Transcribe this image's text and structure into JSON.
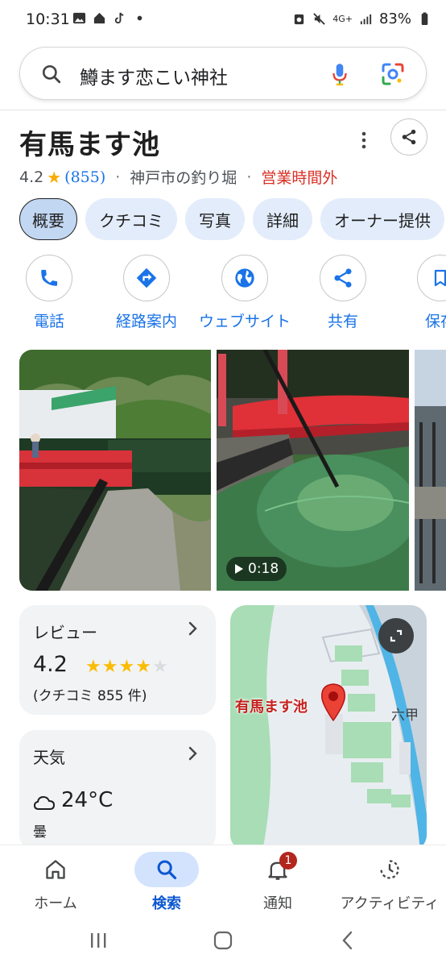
{
  "status_bar": {
    "time": "10:31",
    "network": "4G+",
    "battery": "83%"
  },
  "search": {
    "query": "鱒ます恋こい神社"
  },
  "place": {
    "title": "有馬ます池",
    "rating": "4.2",
    "review_count": "(855)",
    "category": "神戸市の釣り堀",
    "status": "営業時間外",
    "status_color": "#d93025"
  },
  "chips": [
    "概要",
    "クチコミ",
    "写真",
    "詳細",
    "オーナー提供"
  ],
  "actions": [
    {
      "label": "電話",
      "icon": "phone-icon"
    },
    {
      "label": "経路案内",
      "icon": "directions-icon"
    },
    {
      "label": "ウェブサイト",
      "icon": "globe-icon"
    },
    {
      "label": "共有",
      "icon": "share-icon"
    },
    {
      "label": "保存",
      "icon": "bookmark-icon"
    }
  ],
  "photos": {
    "video_duration": "0:18"
  },
  "review_card": {
    "title": "レビュー",
    "score": "4.2",
    "stars_filled": 4,
    "stars_total": 5,
    "count": "(クチコミ 855 件)"
  },
  "weather_card": {
    "title": "天気",
    "temp": "24°C",
    "condition": "曇"
  },
  "map": {
    "label": "有馬ます池",
    "road_label": "六甲"
  },
  "bottom_nav": [
    {
      "label": "ホーム",
      "icon": "home-icon"
    },
    {
      "label": "検索",
      "icon": "search-icon",
      "active": true
    },
    {
      "label": "通知",
      "icon": "bell-icon",
      "badge": "1"
    },
    {
      "label": "アクティビティ",
      "icon": "activity-icon"
    }
  ],
  "colors": {
    "accent_blue": "#1a73e8",
    "chip_bg": "#e3ecfb",
    "star": "#fbbc04"
  }
}
